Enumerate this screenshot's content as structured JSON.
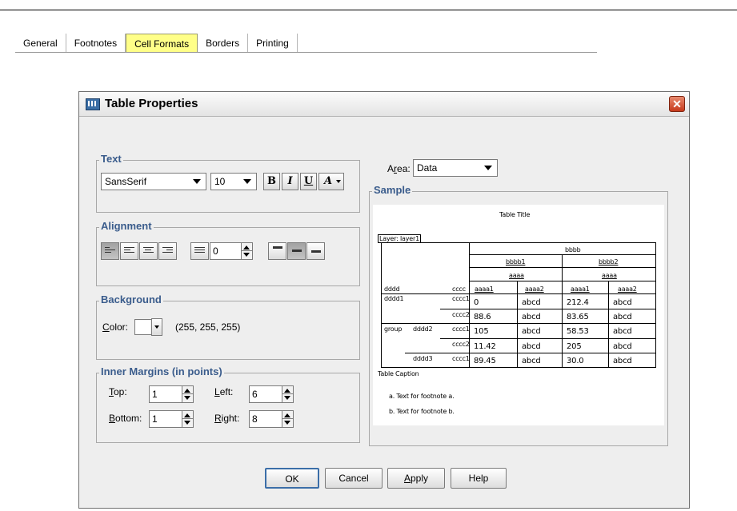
{
  "dialog": {
    "title": "Table Properties",
    "close_label": "✕"
  },
  "tabs": [
    {
      "label": "General",
      "active": false
    },
    {
      "label": "Footnotes",
      "active": false
    },
    {
      "label": "Cell Formats",
      "active": true
    },
    {
      "label": "Borders",
      "active": false
    },
    {
      "label": "Printing",
      "active": false
    }
  ],
  "text_group": {
    "label": "Text",
    "font": "SansSerif",
    "size": "10",
    "bold_label": "B",
    "italic_label": "I",
    "underline_label": "U",
    "color_label": "A"
  },
  "alignment_group": {
    "label": "Alignment",
    "indent_value": "0"
  },
  "background_group": {
    "label": "Background",
    "color_label_prefix": "C",
    "color_label_rest": "olor:",
    "color_value": "(255, 255, 255)",
    "swatch_color": "#ffffff"
  },
  "margins_group": {
    "label": "Inner Margins (in points)",
    "top_label_prefix": "T",
    "top_label_rest": "op:",
    "top_value": "1",
    "left_label_prefix": "L",
    "left_label_rest": "eft:",
    "left_value": "6",
    "bottom_label_prefix": "B",
    "bottom_label_rest": "ottom:",
    "bottom_value": "1",
    "right_label_prefix": "R",
    "right_label_rest": "ight:",
    "right_value": "8"
  },
  "area": {
    "label_prefix": "A",
    "label_underlined": "r",
    "label_rest": "ea:",
    "value": "Data"
  },
  "sample": {
    "label": "Sample",
    "table_title": "Table Title",
    "layer": "Layer: layer1",
    "col_group": "bbbb",
    "col_sub1": "bbbb1",
    "col_sub2": "bbbb2",
    "aaaa1": "aaaa",
    "aaaa2": "aaaa",
    "row_head1": "dddd",
    "row_head2": "cccc",
    "col_heads": [
      "aaaa1",
      "aaaa2",
      "aaaa1",
      "aaaa2"
    ],
    "rows": [
      {
        "g": "",
        "d": "dddd1",
        "c": "cccc1",
        "v": [
          "0",
          "abcd",
          "212.4",
          "abcd"
        ]
      },
      {
        "g": "",
        "d": "",
        "c": "cccc2",
        "v": [
          "88.6",
          "abcd",
          "83.65",
          "abcd"
        ]
      },
      {
        "g": "group",
        "d": "dddd2",
        "c": "cccc1",
        "v": [
          "105",
          "abcd",
          "58.53",
          "abcd"
        ]
      },
      {
        "g": "",
        "d": "",
        "c": "cccc2",
        "v": [
          "11.42",
          "abcd",
          "205",
          "abcd"
        ]
      },
      {
        "g": "",
        "d": "dddd3",
        "c": "cccc1",
        "v": [
          "89.45",
          "abcd",
          "30.0",
          "abcd"
        ]
      }
    ],
    "caption": "Table Caption",
    "footnote_a": "a. Text for footnote a.",
    "footnote_b": "b. Text for footnote b."
  },
  "buttons": {
    "ok": "OK",
    "cancel": "Cancel",
    "apply_prefix": "A",
    "apply_rest": "pply",
    "help": "Help"
  }
}
